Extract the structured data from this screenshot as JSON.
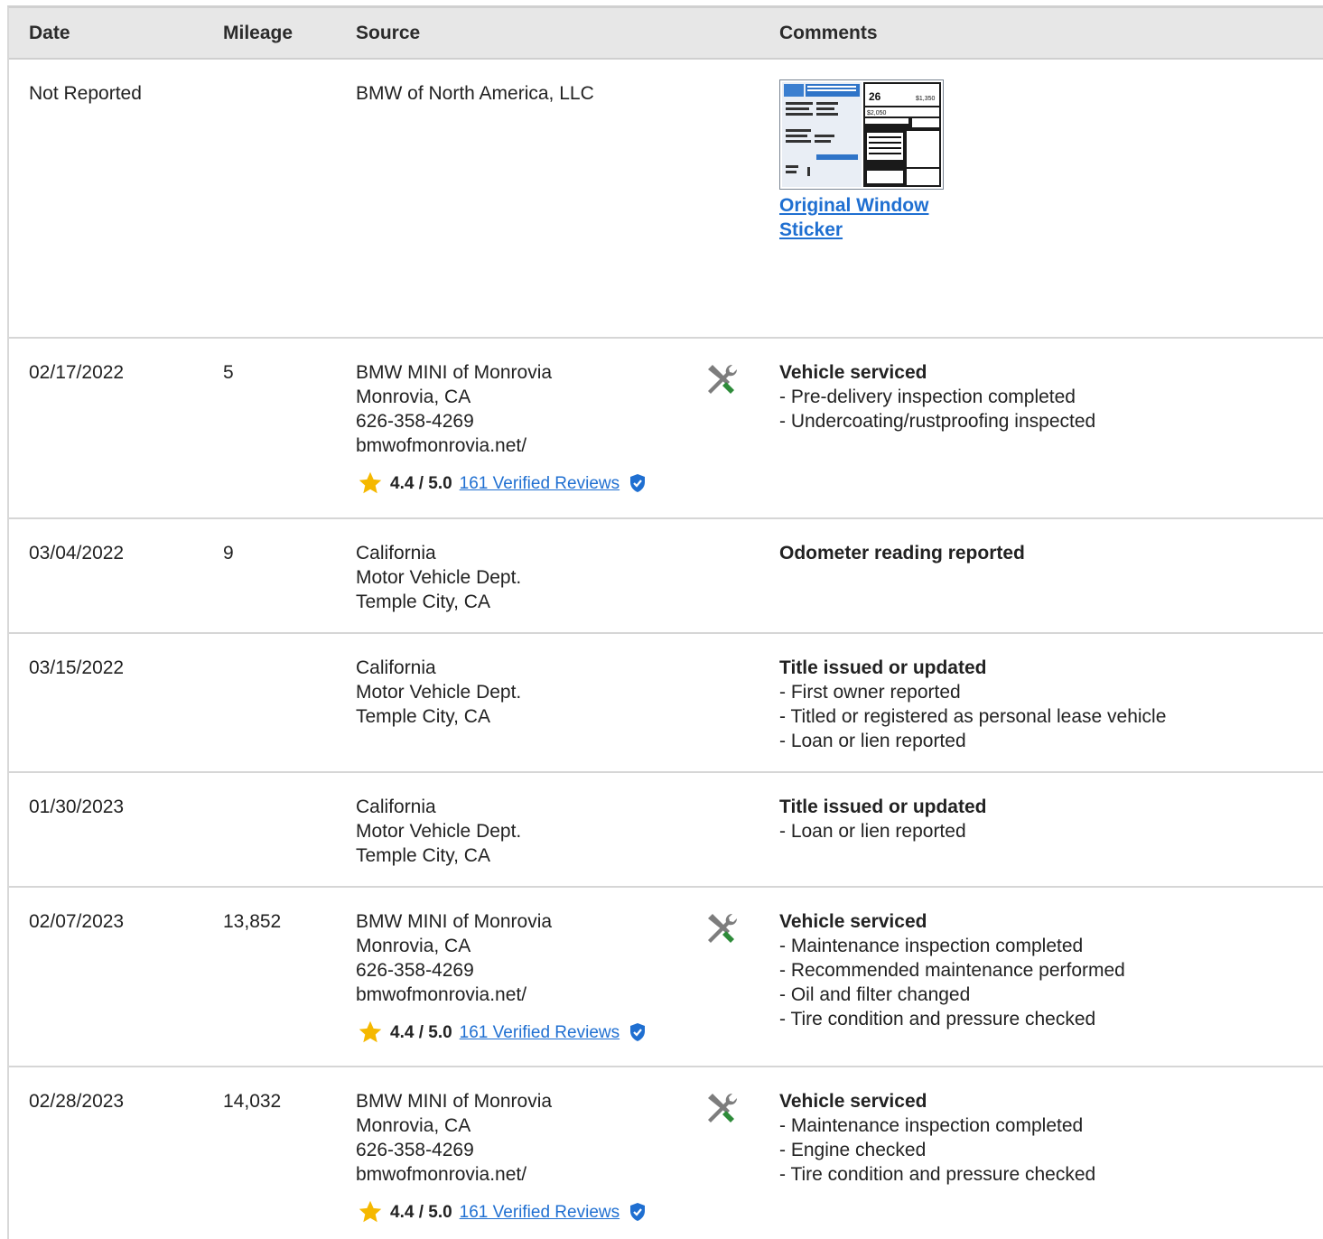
{
  "header": {
    "date": "Date",
    "mileage": "Mileage",
    "source": "Source",
    "comments": "Comments"
  },
  "rows": [
    {
      "date": "Not Reported",
      "mileage": "",
      "source": [
        "BMW of North America, LLC"
      ],
      "sticker_link": "Original Window Sticker"
    },
    {
      "date": "02/17/2022",
      "mileage": "5",
      "source": [
        "BMW MINI of Monrovia",
        "Monrovia, CA",
        "626-358-4269",
        "bmwofmonrovia.net/"
      ],
      "rating": {
        "score": "4.4 / 5.0",
        "reviews": "161 Verified Reviews"
      },
      "icon": "service-tools-icon",
      "comment_title": "Vehicle serviced",
      "comment_items": [
        "- Pre-delivery inspection completed",
        "- Undercoating/rustproofing inspected"
      ]
    },
    {
      "date": "03/04/2022",
      "mileage": "9",
      "source": [
        "California",
        "Motor Vehicle Dept.",
        "Temple City, CA"
      ],
      "comment_title": "Odometer reading reported",
      "comment_items": []
    },
    {
      "date": "03/15/2022",
      "mileage": "",
      "source": [
        "California",
        "Motor Vehicle Dept.",
        "Temple City, CA"
      ],
      "comment_title": "Title issued or updated",
      "comment_items": [
        "- First owner reported",
        "- Titled or registered as personal lease vehicle",
        "- Loan or lien reported"
      ]
    },
    {
      "date": "01/30/2023",
      "mileage": "",
      "source": [
        "California",
        "Motor Vehicle Dept.",
        "Temple City, CA"
      ],
      "comment_title": "Title issued or updated",
      "comment_items": [
        "- Loan or lien reported"
      ]
    },
    {
      "date": "02/07/2023",
      "mileage": "13,852",
      "source": [
        "BMW MINI of Monrovia",
        "Monrovia, CA",
        "626-358-4269",
        "bmwofmonrovia.net/"
      ],
      "rating": {
        "score": "4.4 / 5.0",
        "reviews": "161 Verified Reviews"
      },
      "icon": "service-tools-icon",
      "comment_title": "Vehicle serviced",
      "comment_items": [
        "- Maintenance inspection completed",
        "- Recommended maintenance performed",
        "- Oil and filter changed",
        "- Tire condition and pressure checked"
      ]
    },
    {
      "date": "02/28/2023",
      "mileage": "14,032",
      "source": [
        "BMW MINI of Monrovia",
        "Monrovia, CA",
        "626-358-4269",
        "bmwofmonrovia.net/"
      ],
      "rating": {
        "score": "4.4 / 5.0",
        "reviews": "161 Verified Reviews"
      },
      "icon": "service-tools-icon",
      "comment_title": "Vehicle serviced",
      "comment_items": [
        "- Maintenance inspection completed",
        "- Engine checked",
        "- Tire condition and pressure checked"
      ]
    }
  ],
  "colors": {
    "link": "#1f6fd1",
    "star": "#f5b800",
    "shield": "#1f6fd1",
    "wrench_handle": "#2e8b3a",
    "tool_gray": "#7d7d7d"
  }
}
